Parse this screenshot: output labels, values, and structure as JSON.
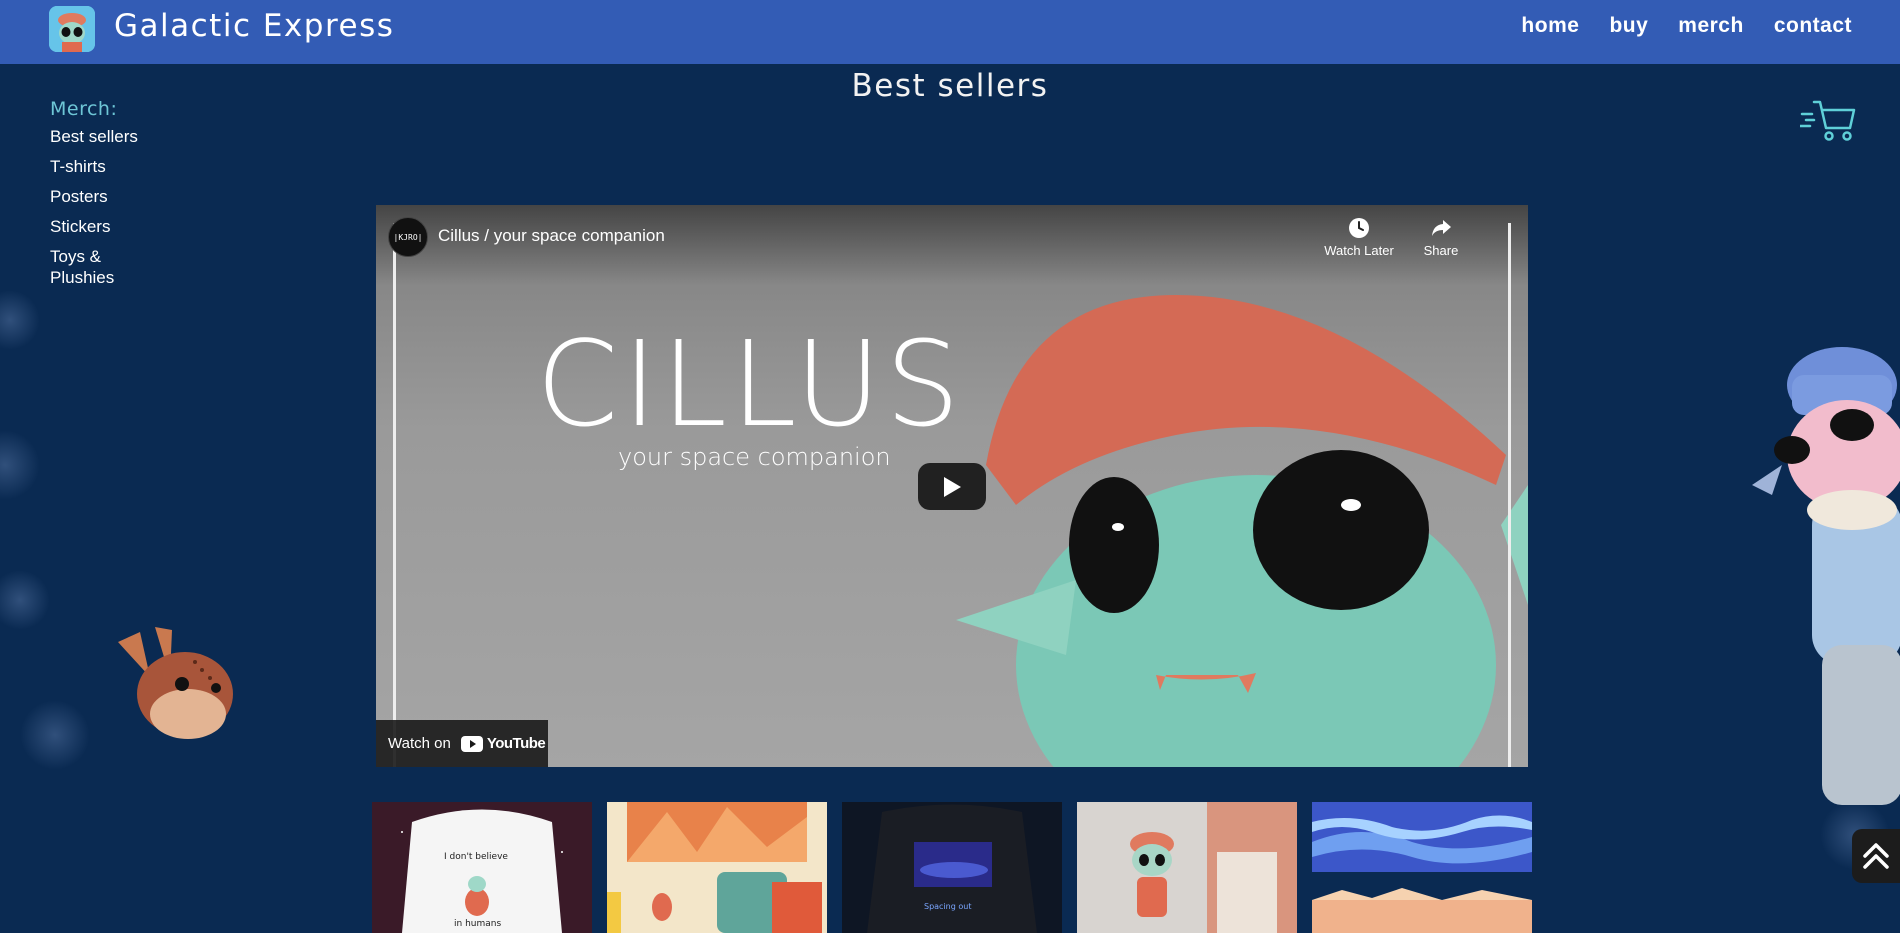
{
  "header": {
    "brand": "Galactic Express",
    "nav": [
      "home",
      "buy",
      "merch",
      "contact"
    ]
  },
  "page_title": "Best sellers",
  "sidebar": {
    "title": "Merch:",
    "items": [
      "Best sellers",
      "T-shirts",
      "Posters",
      "Stickers",
      "Toys & Plushies"
    ]
  },
  "video": {
    "channel_badge": "|KJRO|",
    "title": "Cillus / your space companion",
    "watch_later": "Watch Later",
    "share": "Share",
    "headline": "CILLUS",
    "tagline": "your space companion",
    "watch_on": "Watch on",
    "youtube": "YouTube"
  },
  "thumbnails": [
    {
      "name": "tshirt-white",
      "caption_line1": "I don't believe",
      "caption_line2": "in humans"
    },
    {
      "name": "poster-room"
    },
    {
      "name": "tshirt-black",
      "caption": "Spacing out"
    },
    {
      "name": "toy-figure"
    },
    {
      "name": "sky-prints"
    }
  ],
  "colors": {
    "background": "#0a2a52",
    "header": "#335cb5",
    "accent": "#6ec6d6"
  },
  "icons": {
    "cart": "cart-icon",
    "scroll_top": "chevrons-up-icon",
    "play": "play-icon"
  }
}
